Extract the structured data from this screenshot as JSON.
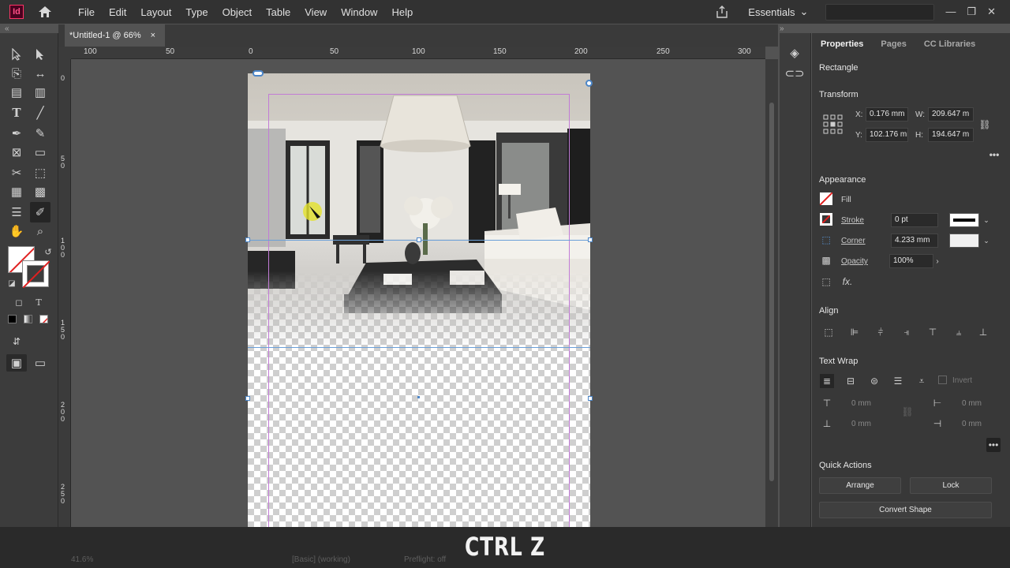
{
  "app": {
    "logo": "Id"
  },
  "menu": [
    "File",
    "Edit",
    "Layout",
    "Type",
    "Object",
    "Table",
    "View",
    "Window",
    "Help"
  ],
  "workspace": "Essentials",
  "document_tab": {
    "title": "*Untitled-1 @ 66%",
    "close": "×"
  },
  "ruler": {
    "h_labels": [
      "100",
      "50",
      "0",
      "50",
      "100",
      "150",
      "200",
      "250",
      "300"
    ],
    "v_labels": [
      "0",
      "50",
      "100",
      "150",
      "200",
      "250"
    ]
  },
  "panel": {
    "tabs": [
      "Properties",
      "Pages",
      "CC Libraries"
    ],
    "object_type": "Rectangle",
    "transform": {
      "heading": "Transform",
      "x_label": "X:",
      "x": "0.176 mm",
      "y_label": "Y:",
      "y": "102.176 mm",
      "w_label": "W:",
      "w": "209.647 m",
      "h_label": "H:",
      "h": "194.647 m"
    },
    "appearance": {
      "heading": "Appearance",
      "fill": "Fill",
      "stroke": "Stroke",
      "stroke_value": "0 pt",
      "corner": "Corner",
      "corner_value": "4.233 mm",
      "opacity": "Opacity",
      "opacity_value": "100%"
    },
    "align": {
      "heading": "Align"
    },
    "text_wrap": {
      "heading": "Text Wrap",
      "invert": "Invert",
      "top": "0 mm",
      "left": "0 mm",
      "bottom": "0 mm",
      "right": "0 mm"
    },
    "quick_actions": {
      "heading": "Quick Actions",
      "arrange": "Arrange",
      "lock": "Lock",
      "convert_shape": "Convert Shape"
    }
  },
  "status": {
    "zoom": "41.6%",
    "preflight": "Preflight: off",
    "mode": "[Basic] (working)"
  },
  "overlay": {
    "shortcut": "CTRL Z"
  },
  "colors": {
    "accent_blue": "#4c86c8",
    "margin": "#c27cd6",
    "brand": "#ff3366"
  }
}
